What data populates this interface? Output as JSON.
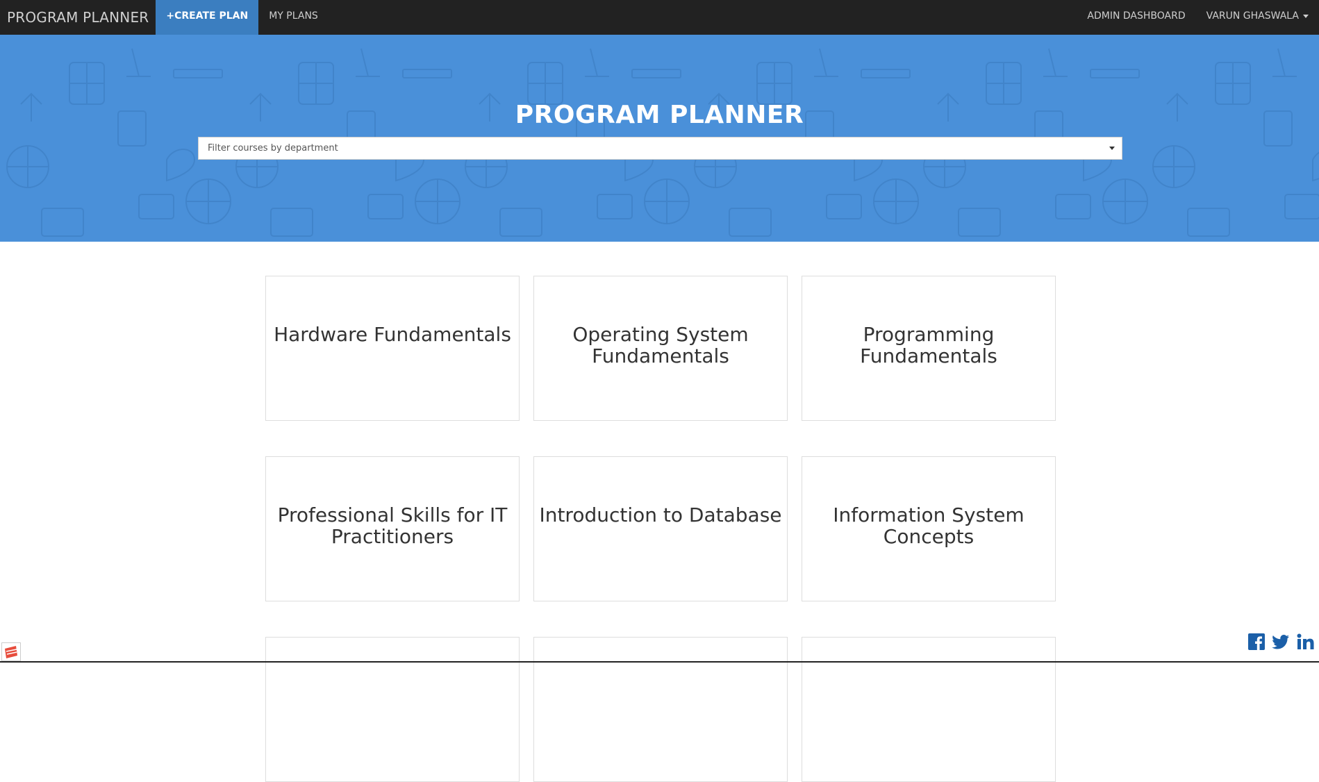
{
  "navbar": {
    "brand": "PROGRAM PLANNER",
    "create_plan": "CREATE PLAN",
    "my_plans": "MY PLANS",
    "admin_dashboard": "ADMIN DASHBOARD",
    "user_name": "VARUN GHASWALA"
  },
  "hero": {
    "title": "PROGRAM PLANNER",
    "filter_placeholder": "Filter courses by department"
  },
  "courses": [
    {
      "title": "Hardware Fundamentals"
    },
    {
      "title": "Operating System Fundamentals"
    },
    {
      "title": "Programming Fundamentals"
    },
    {
      "title": "Professional Skills for IT Practitioners"
    },
    {
      "title": "Introduction to Database"
    },
    {
      "title": "Information System Concepts"
    },
    {
      "title": ""
    },
    {
      "title": ""
    },
    {
      "title": ""
    }
  ],
  "icons": {
    "plus": "plus-icon",
    "facebook": "facebook-icon",
    "twitter": "twitter-icon",
    "linkedin": "linkedin-icon"
  },
  "colors": {
    "navbar_bg": "#222222",
    "active_tab": "#3b7ec0",
    "hero_bg": "#4a90d9",
    "social_blue": "#1b5fa8"
  }
}
